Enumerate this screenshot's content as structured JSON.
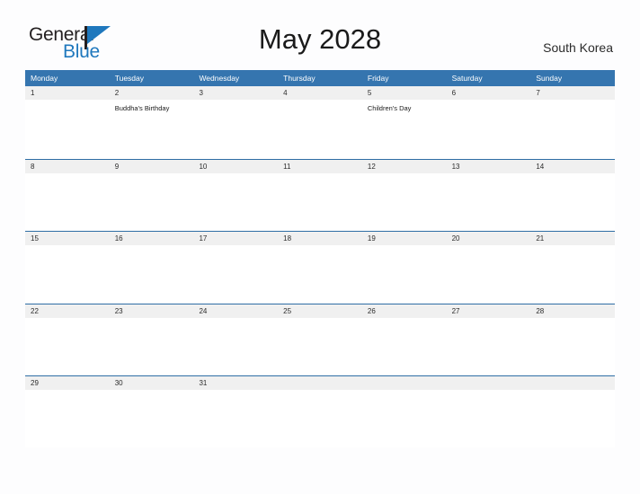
{
  "brand": {
    "name_part1": "General",
    "name_part2": "Blue"
  },
  "header": {
    "title": "May 2028",
    "country": "South Korea"
  },
  "colors": {
    "header_blue": "#3575af",
    "row_border_blue": "#2f6ea5",
    "date_band_gray": "#f0f0f0",
    "logo_blue": "#1f78bd",
    "page_background": "#fdfdfe"
  },
  "calendar": {
    "weekdays": [
      "Monday",
      "Tuesday",
      "Wednesday",
      "Thursday",
      "Friday",
      "Saturday",
      "Sunday"
    ],
    "weeks": [
      {
        "days": [
          {
            "number": "1",
            "events": []
          },
          {
            "number": "2",
            "events": [
              "Buddha's Birthday"
            ]
          },
          {
            "number": "3",
            "events": []
          },
          {
            "number": "4",
            "events": []
          },
          {
            "number": "5",
            "events": [
              "Children's Day"
            ]
          },
          {
            "number": "6",
            "events": []
          },
          {
            "number": "7",
            "events": []
          }
        ]
      },
      {
        "days": [
          {
            "number": "8",
            "events": []
          },
          {
            "number": "9",
            "events": []
          },
          {
            "number": "10",
            "events": []
          },
          {
            "number": "11",
            "events": []
          },
          {
            "number": "12",
            "events": []
          },
          {
            "number": "13",
            "events": []
          },
          {
            "number": "14",
            "events": []
          }
        ]
      },
      {
        "days": [
          {
            "number": "15",
            "events": []
          },
          {
            "number": "16",
            "events": []
          },
          {
            "number": "17",
            "events": []
          },
          {
            "number": "18",
            "events": []
          },
          {
            "number": "19",
            "events": []
          },
          {
            "number": "20",
            "events": []
          },
          {
            "number": "21",
            "events": []
          }
        ]
      },
      {
        "days": [
          {
            "number": "22",
            "events": []
          },
          {
            "number": "23",
            "events": []
          },
          {
            "number": "24",
            "events": []
          },
          {
            "number": "25",
            "events": []
          },
          {
            "number": "26",
            "events": []
          },
          {
            "number": "27",
            "events": []
          },
          {
            "number": "28",
            "events": []
          }
        ]
      },
      {
        "days": [
          {
            "number": "29",
            "events": []
          },
          {
            "number": "30",
            "events": []
          },
          {
            "number": "31",
            "events": []
          },
          {
            "number": "",
            "events": []
          },
          {
            "number": "",
            "events": []
          },
          {
            "number": "",
            "events": []
          },
          {
            "number": "",
            "events": []
          }
        ]
      }
    ]
  }
}
